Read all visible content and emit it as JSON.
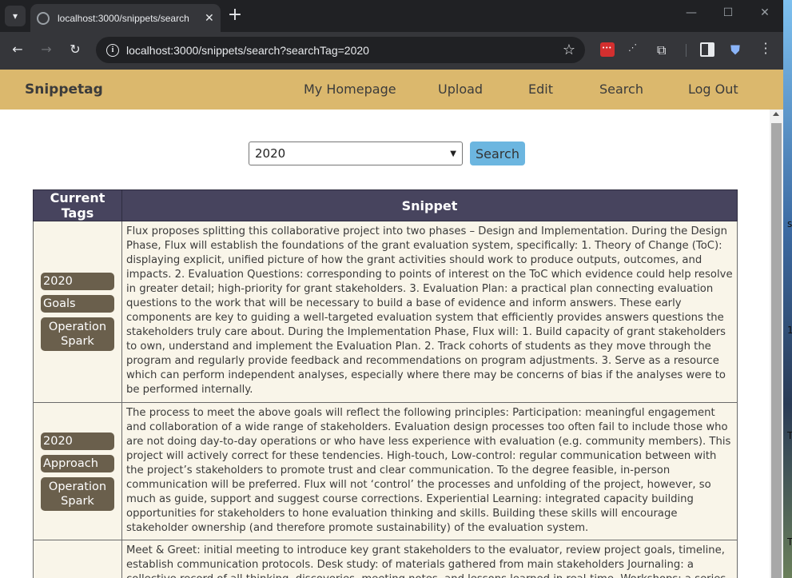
{
  "browser": {
    "tab_title": "localhost:3000/snippets/search",
    "url": "localhost:3000/snippets/search?searchTag=2020"
  },
  "navbar": {
    "brand": "Snippetag",
    "links": [
      "My Homepage",
      "Upload",
      "Edit",
      "Search",
      "Log Out"
    ]
  },
  "search": {
    "selected_tag": "2020",
    "button_label": "Search"
  },
  "table": {
    "headers": [
      "Current Tags",
      "Snippet"
    ],
    "rows": [
      {
        "tags": [
          "2020",
          "Goals",
          "Operation Spark"
        ],
        "text": "Flux proposes splitting this collaborative project into two phases – Design and Implementation. During the Design Phase, Flux will establish the foundations of the grant evaluation system, specifically: 1. Theory of Change (ToC): displaying explicit, unified picture of how the grant activities should work to produce outputs, outcomes, and impacts. 2. Evaluation Questions: corresponding to points of interest on the ToC which evidence could help resolve in greater detail; high-priority for grant stakeholders. 3. Evaluation Plan: a practical plan connecting evaluation questions to the work that will be necessary to build a base of evidence and inform answers. These early components are key to guiding a well-targeted evaluation system that efficiently provides answers questions the stakeholders truly care about. During the Implementation Phase, Flux will: 1. Build capacity of grant stakeholders to own, understand and implement the Evaluation Plan. 2. Track cohorts of students as they move through the program and regularly provide feedback and recommendations on program adjustments. 3. Serve as a resource which can perform independent analyses, especially where there may be concerns of bias if the analyses were to be performed internally."
      },
      {
        "tags": [
          "2020",
          "Approach",
          "Operation Spark"
        ],
        "text": "The process to meet the above goals will reflect the following principles:    Participation: meaningful engagement and collaboration of a wide range of stakeholders. Evaluation design processes too often fail to include those who are not doing day-to-day operations or who have less experience with evaluation (e.g. community members). This project will actively correct for these tendencies.    High-touch, Low-control: regular communication between with the project’s stakeholders to promote trust and clear communication. To the degree feasible, in-person communication will be preferred. Flux will not ‘control’ the processes and unfolding of the project, however, so much as guide, support and suggest course corrections.    Experiential Learning: integrated capacity building opportunities for stakeholders to hone evaluation thinking and skills. Building these skills will encourage stakeholder ownership (and therefore promote sustainability) of the evaluation system."
      },
      {
        "tags": [],
        "text": "Meet & Greet: initial meeting to introduce key grant stakeholders to the evaluator, review project goals, timeline, establish communication protocols. Desk study: of materials gathered from main stakeholders Journaling: a collective record of all thinking, discoveries, meeting notes, and lessons learned in real-time. Workshops: a series of"
      }
    ]
  },
  "desktop_chars": [
    "s",
    "1",
    "T",
    "T"
  ]
}
